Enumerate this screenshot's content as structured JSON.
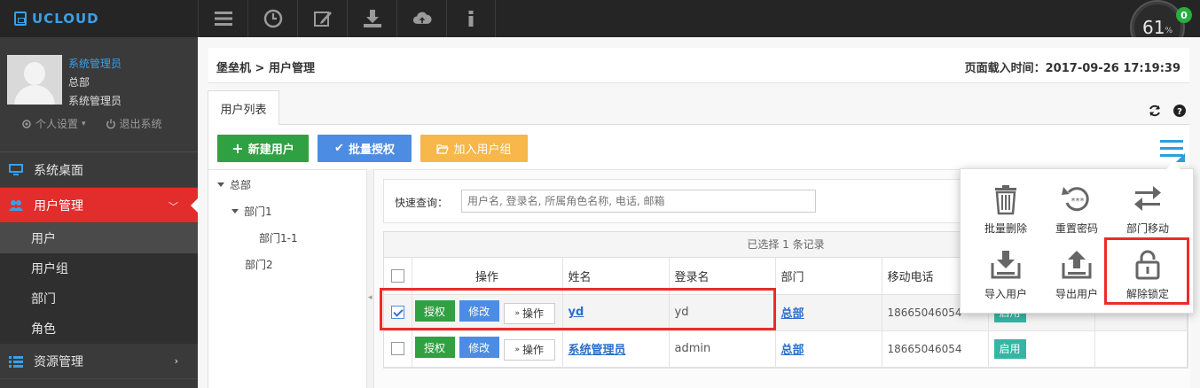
{
  "app": {
    "logo_text": "UCLOUD"
  },
  "toolbar": {
    "icons": [
      "menu-icon",
      "clock-icon",
      "edit-icon",
      "download-icon",
      "cloud-upload-icon",
      "info-icon"
    ]
  },
  "gauge": {
    "value": "61",
    "unit": "%",
    "badge": "0"
  },
  "profile": {
    "name": "系统管理员",
    "dept": "总部",
    "role": "系统管理员",
    "settings_label": "个人设置",
    "logout_label": "退出系统"
  },
  "nav": {
    "desktop": "系统桌面",
    "user_mgmt": "用户管理",
    "sub": [
      "用户",
      "用户组",
      "部门",
      "角色"
    ],
    "resource_mgmt": "资源管理"
  },
  "breadcrumb": "堡垒机 > 用户管理",
  "load_time": "页面载入时间：2017-09-26 17:19:39",
  "tab_label": "用户列表",
  "buttons": {
    "new_user": "新建用户",
    "batch_auth": "批量授权",
    "add_group": "加入用户组"
  },
  "tree": {
    "root": "总部",
    "dept1": "部门1",
    "dept1_1": "部门1-1",
    "dept2": "部门2"
  },
  "search": {
    "label": "快速查询：",
    "placeholder": "用户名, 登录名, 所属角色名称, 电话, 邮箱"
  },
  "table": {
    "selection_info": "已选择 1 条记录",
    "headers": [
      "操作",
      "姓名",
      "登录名",
      "部门",
      "移动电话"
    ],
    "action_labels": {
      "auth": "授权",
      "edit": "修改",
      "more": "操作"
    },
    "rows": [
      {
        "name": "yd",
        "login": "yd",
        "dept": "总部",
        "phone": "18665046054",
        "status": "启用",
        "checked": true
      },
      {
        "name": "系统管理员",
        "login": "admin",
        "dept": "总部",
        "phone": "18665046054",
        "status": "启用",
        "checked": false
      }
    ]
  },
  "popup_menu": {
    "items": [
      "批量删除",
      "重置密码",
      "部门移动",
      "导入用户",
      "导出用户",
      "解除锁定"
    ]
  },
  "colors": {
    "accent_red": "#e32c2c",
    "green": "#30a143",
    "blue": "#4c8de3",
    "orange": "#f7b74a",
    "teal": "#35b6a4"
  }
}
